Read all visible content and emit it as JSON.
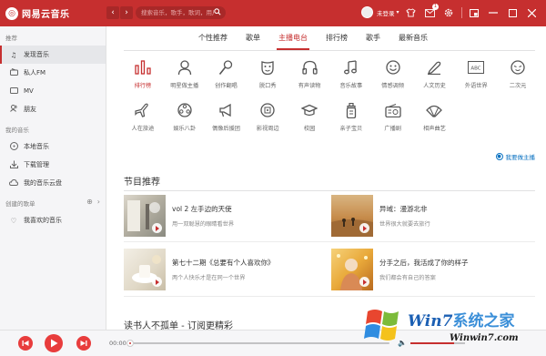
{
  "app": {
    "logo_text": "网易云音乐",
    "brand_color": "#c62f2f"
  },
  "topbar": {
    "back_label": "‹",
    "forward_label": "›",
    "search_placeholder": "搜索音乐，歌手，歌词，用户",
    "user_name": "未登录",
    "user_caret": "▾",
    "mail_badge": "1"
  },
  "sidebar": {
    "section_recommend": "推荐",
    "recommend_items": [
      {
        "label": "发现音乐",
        "icon": "music-note-icon"
      },
      {
        "label": "私人FM",
        "icon": "radio-icon"
      },
      {
        "label": "MV",
        "icon": "mv-icon"
      },
      {
        "label": "朋友",
        "icon": "friends-icon"
      }
    ],
    "section_my_music": "我的音乐",
    "my_music_items": [
      {
        "label": "本地音乐",
        "icon": "disc-icon"
      },
      {
        "label": "下载管理",
        "icon": "download-icon"
      },
      {
        "label": "我的音乐云盘",
        "icon": "cloud-icon"
      }
    ],
    "section_created": "创建的歌单",
    "created_items": [
      {
        "label": "我喜欢的音乐",
        "icon": "heart-icon"
      }
    ]
  },
  "tabs": [
    "个性推荐",
    "歌单",
    "主播电台",
    "排行榜",
    "歌手",
    "最新音乐"
  ],
  "active_tab": "主播电台",
  "categories": [
    {
      "label": "排行榜",
      "icon": "ranking-icon"
    },
    {
      "label": "明星做主播",
      "icon": "star-host-icon"
    },
    {
      "label": "创作翻唱",
      "icon": "microphone-icon"
    },
    {
      "label": "脱口秀",
      "icon": "mask-icon"
    },
    {
      "label": "有声读物",
      "icon": "headphones-icon"
    },
    {
      "label": "音乐故事",
      "icon": "music-note-icon"
    },
    {
      "label": "情感调频",
      "icon": "smile-icon"
    },
    {
      "label": "人文历史",
      "icon": "pen-icon"
    },
    {
      "label": "外语世界",
      "icon": "abc-icon"
    },
    {
      "label": "二次元",
      "icon": "anime-face-icon"
    },
    {
      "label": "人在旅途",
      "icon": "airplane-icon"
    },
    {
      "label": "娱乐八卦",
      "icon": "film-reel-icon"
    },
    {
      "label": "偶像后援团",
      "icon": "loudspeaker-icon"
    },
    {
      "label": "影视周边",
      "icon": "film-icon"
    },
    {
      "label": "校园",
      "icon": "graduation-cap-icon"
    },
    {
      "label": "亲子宝贝",
      "icon": "baby-bottle-icon"
    },
    {
      "label": "广播剧",
      "icon": "radio-set-icon"
    },
    {
      "label": "相声曲艺",
      "icon": "fan-icon"
    }
  ],
  "apply_link": "我要做主播",
  "section_programs": "节目推荐",
  "programs": [
    {
      "title": "vol 2 左手边的天使",
      "subtitle": "用一双聪慧的眼睛看世界"
    },
    {
      "title": "异域：漫游北非",
      "subtitle": "世界很大就要去旅行"
    },
    {
      "title": "第七十二期《总要有个人喜欢你》",
      "subtitle": "两个人快乐才是在同一个世界"
    },
    {
      "title": "分手之后，我活成了你的样子",
      "subtitle": "我们都会有自己的答案"
    }
  ],
  "next_section": "读书人不孤单 - 订阅更精彩",
  "player": {
    "current_time": "00:00",
    "progress": 0.0,
    "volume": 0.8
  },
  "watermark": {
    "brand_latin": "Win7",
    "brand_cn": "系统之家",
    "url": "Winwin7.com"
  }
}
